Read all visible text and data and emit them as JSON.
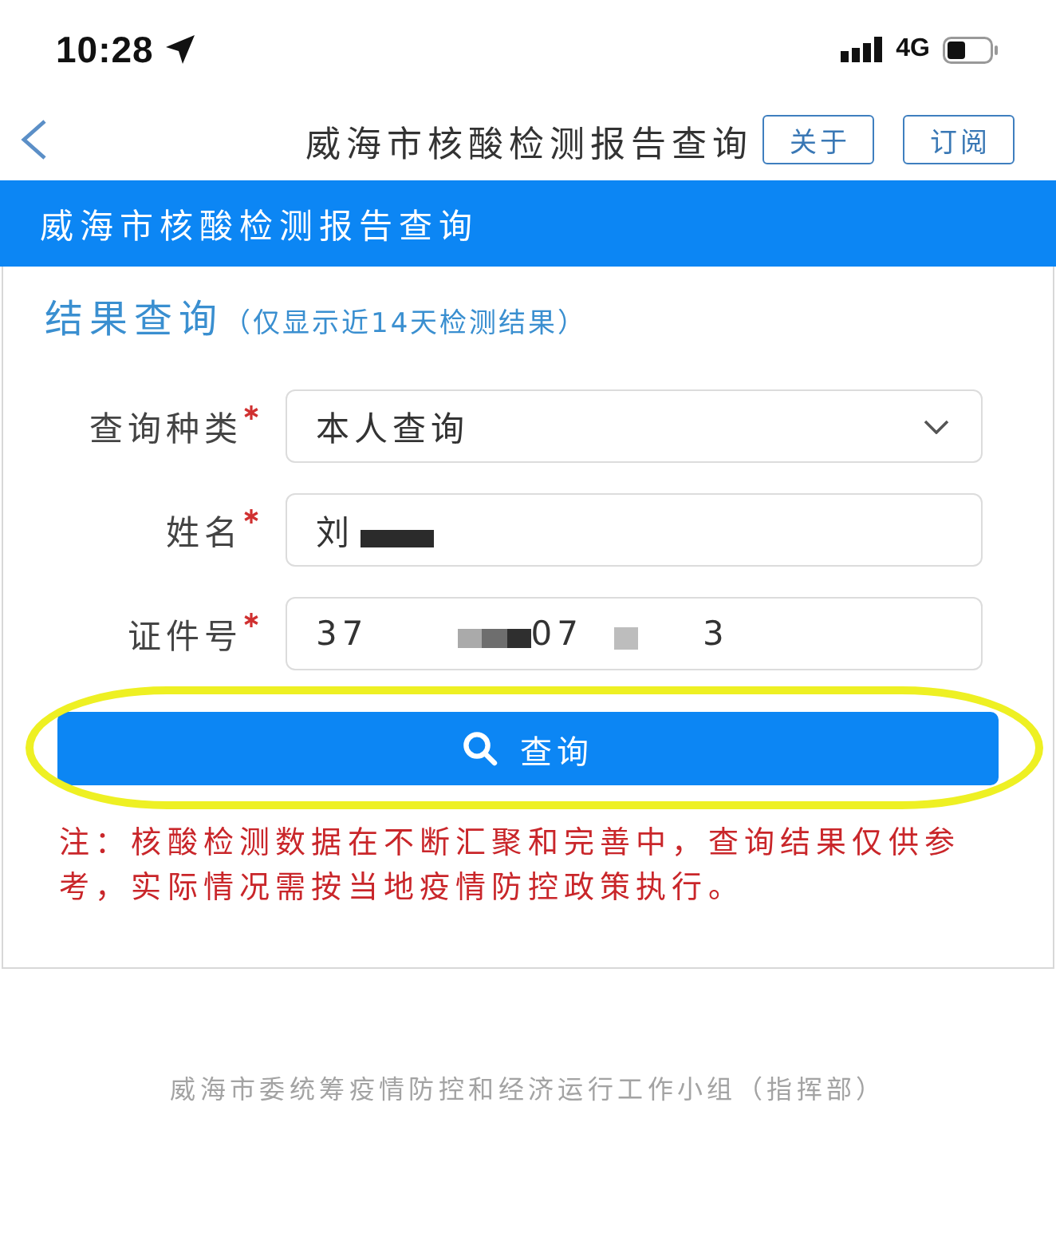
{
  "status_bar": {
    "time": "10:28",
    "network": "4G"
  },
  "nav_bar": {
    "title": "威海市核酸检测报告查询",
    "buttons": [
      "关于",
      "订阅"
    ]
  },
  "header": {
    "title": "威海市核酸检测报告查询"
  },
  "result_query": {
    "title": "结果查询",
    "subtitle": "（仅显示近14天检测结果）",
    "fields": [
      {
        "kind": "select",
        "label": "查询种类",
        "required": true,
        "segments": [
          {
            "kind": "text",
            "text": "本人查询"
          }
        ]
      },
      {
        "kind": "input",
        "label": "姓名",
        "required": true,
        "segments": [
          {
            "kind": "text",
            "text": "刘"
          },
          {
            "kind": "blackout"
          }
        ]
      },
      {
        "kind": "input",
        "label": "证件号",
        "required": true,
        "segments": [
          {
            "kind": "text",
            "text": "37"
          },
          {
            "kind": "mosaic"
          },
          {
            "kind": "text",
            "text": "07"
          },
          {
            "kind": "blur"
          },
          {
            "kind": "text",
            "text": "3"
          }
        ]
      }
    ],
    "query_button": {
      "label": "查询",
      "highlighted": true
    },
    "note": "注：核酸检测数据在不断汇聚和完善中，查询结果仅供参考，实际情况需按当地疫情防控政策执行。"
  },
  "footer": "威海市委统筹疫情防控和经济运行工作小组（指挥部）"
}
